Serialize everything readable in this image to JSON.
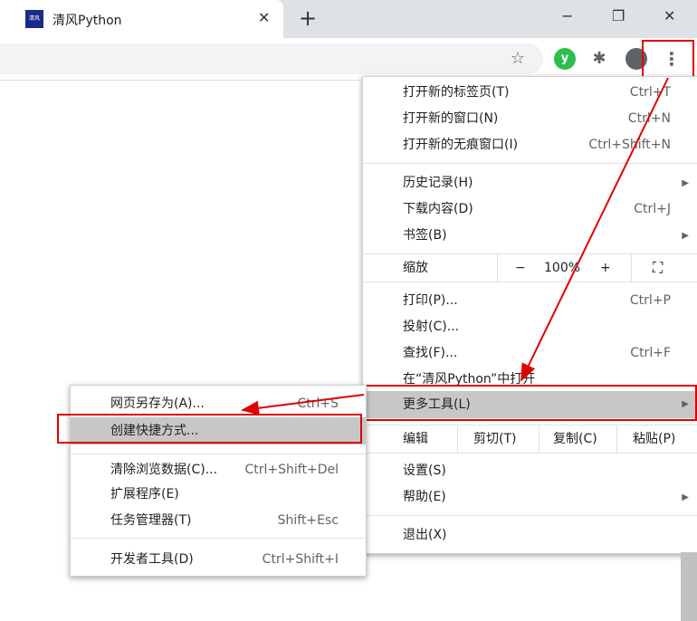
{
  "tab": {
    "title": "清风Python",
    "favicon_text": "清风Python"
  },
  "main_menu": {
    "items": [
      {
        "label": "打开新的标签页(T)",
        "shortcut": "Ctrl+T"
      },
      {
        "label": "打开新的窗口(N)",
        "shortcut": "Ctrl+N"
      },
      {
        "label": "打开新的无痕窗口(I)",
        "shortcut": "Ctrl+Shift+N"
      },
      {
        "label": "历史记录(H)",
        "shortcut": ""
      },
      {
        "label": "下载内容(D)",
        "shortcut": "Ctrl+J"
      },
      {
        "label": "书签(B)",
        "shortcut": ""
      },
      {
        "label": "打印(P)...",
        "shortcut": "Ctrl+P"
      },
      {
        "label": "投射(C)...",
        "shortcut": ""
      },
      {
        "label": "查找(F)...",
        "shortcut": "Ctrl+F"
      },
      {
        "label": "在“清风Python”中打开",
        "shortcut": ""
      },
      {
        "label": "更多工具(L)",
        "shortcut": ""
      },
      {
        "label": "设置(S)",
        "shortcut": ""
      },
      {
        "label": "帮助(E)",
        "shortcut": ""
      },
      {
        "label": "退出(X)",
        "shortcut": ""
      }
    ],
    "zoom": {
      "label": "缩放",
      "minus": "−",
      "value": "100%",
      "plus": "+"
    },
    "edit": {
      "label": "编辑",
      "cut": "剪切(T)",
      "copy": "复制(C)",
      "paste": "粘贴(P)"
    }
  },
  "sub_menu": {
    "items": [
      {
        "label": "网页另存为(A)...",
        "shortcut": "Ctrl+S"
      },
      {
        "label": "创建快捷方式...",
        "shortcut": ""
      },
      {
        "label": "清除浏览数据(C)...",
        "shortcut": "Ctrl+Shift+Del"
      },
      {
        "label": "扩展程序(E)",
        "shortcut": ""
      },
      {
        "label": "任务管理器(T)",
        "shortcut": "Shift+Esc"
      },
      {
        "label": "开发者工具(D)",
        "shortcut": "Ctrl+Shift+I"
      }
    ]
  },
  "icons": {
    "close": "✕",
    "plus": "+",
    "minimize": "−",
    "restore": "❐",
    "star": "☆",
    "ext": "y",
    "puzzle": "✱",
    "dots": "⋮",
    "arrow": "▶",
    "fullscreen": "⛶"
  },
  "colors": {
    "annotation_red": "#e00000",
    "highlight": "#c7c7c7"
  }
}
